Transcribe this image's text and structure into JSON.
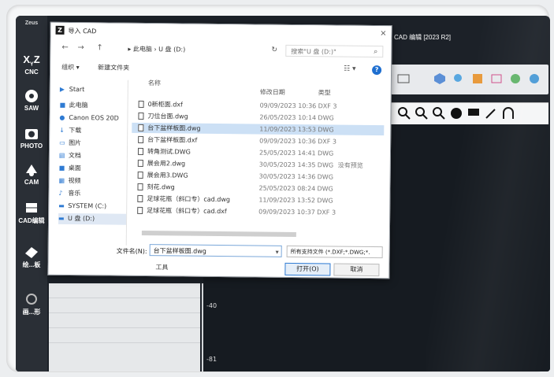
{
  "left_toolbar": {
    "top_label": "Zeus",
    "items": [
      {
        "label": "CNC",
        "icon": "xyz-icon"
      },
      {
        "label": "SAW",
        "icon": "saw-blade-icon"
      },
      {
        "label": "PHOTO",
        "icon": "camera-icon"
      },
      {
        "label": "CAM",
        "icon": "cam-icon"
      },
      {
        "label": "CAD编辑",
        "icon": "cad-edit-icon"
      },
      {
        "label": "绘...板",
        "icon": "draw-board-icon"
      },
      {
        "label": "画...形",
        "icon": "shape-icon"
      }
    ]
  },
  "cad_window": {
    "title": "CAD 编辑 [2023 R2]"
  },
  "ruler": {
    "labels": [
      "-40",
      "-81"
    ]
  },
  "dialog": {
    "title": "导入 CAD",
    "close": "×",
    "nav": {
      "back": "←",
      "forward": "→",
      "up": "↑",
      "breadcrumb": "▸ 此电脑 › U 盘 (D:)",
      "refresh": "↻",
      "search_placeholder": "搜索\"U 盘 (D:)\"",
      "search_icon": "⌕"
    },
    "commands": {
      "organize": "组织 ▾",
      "new_folder": "新建文件夹",
      "view": "☷ ▾",
      "help": "?"
    },
    "sidebar": [
      {
        "label": "Start",
        "icon": "▶"
      },
      {
        "label": "此电脑",
        "icon": "■"
      },
      {
        "label": "Canon EOS 20D",
        "icon": "●"
      },
      {
        "label": "下载",
        "icon": "↓"
      },
      {
        "label": "图片",
        "icon": "▭"
      },
      {
        "label": "文档",
        "icon": "▤"
      },
      {
        "label": "桌面",
        "icon": "■"
      },
      {
        "label": "视频",
        "icon": "▦"
      },
      {
        "label": "音乐",
        "icon": "♪"
      },
      {
        "label": "SYSTEM (C:)",
        "icon": "▬"
      },
      {
        "label": "U 盘 (D:)",
        "icon": "▬"
      }
    ],
    "columns": {
      "name": "名称",
      "date": "修改日期",
      "type": "类型"
    },
    "files": [
      {
        "name": "0新柜面.dxf",
        "date": "09/09/2023 10:36",
        "type": "DXF 3",
        "extra": ""
      },
      {
        "name": "刀位台面.dwg",
        "date": "26/05/2023 10:14",
        "type": "DWG",
        "extra": ""
      },
      {
        "name": "台下盆样板图.dwg",
        "date": "11/09/2023 13:53",
        "type": "DWG",
        "extra": ""
      },
      {
        "name": "台下盆样板图.dxf",
        "date": "09/09/2023 10:36",
        "type": "DXF 3",
        "extra": ""
      },
      {
        "name": "转角测试.DWG",
        "date": "25/05/2023 14:41",
        "type": "DWG",
        "extra": ""
      },
      {
        "name": "展会用2.dwg",
        "date": "30/05/2023 14:35",
        "type": "DWG",
        "extra": "没有预览"
      },
      {
        "name": "展会用3.DWG",
        "date": "30/05/2023 14:36",
        "type": "DWG",
        "extra": ""
      },
      {
        "name": "刻花.dwg",
        "date": "25/05/2023 08:24",
        "type": "DWG",
        "extra": ""
      },
      {
        "name": "足球花瓶（斜口专）cad.dwg",
        "date": "11/09/2023 13:52",
        "type": "DWG",
        "extra": ""
      },
      {
        "name": "足球花瓶（斜口专）cad.dxf",
        "date": "09/09/2023 10:37",
        "type": "DXF 3",
        "extra": ""
      }
    ],
    "filename_label": "文件名(N):",
    "filename_value": "台下盆样板图.dwg",
    "filename_dropdown": "▾",
    "filetype_value": "所有支持文件 (*.DXF;*.DWG;*.",
    "tools_label": "工具",
    "open_label": "打开(O)",
    "cancel_label": "取消"
  }
}
